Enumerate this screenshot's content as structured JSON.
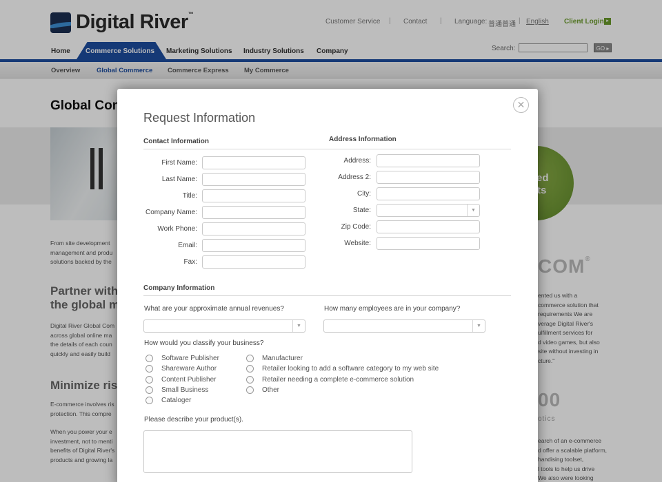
{
  "header": {
    "logo_text": "Digital River",
    "logo_tm": "™",
    "util_links": {
      "customer_service": "Customer Service",
      "contact": "Contact",
      "language_label": "Language:",
      "language_other": "普通普通",
      "language_current": "English",
      "separator": "|"
    },
    "client_login": "Client Login",
    "client_login_arrow": "▸",
    "search_label": "Search:",
    "search_go": "GO ▸"
  },
  "nav": {
    "home": "Home",
    "commerce_solutions": "Commerce Solutions",
    "marketing_solutions": "Marketing Solutions",
    "industry_solutions": "Industry Solutions",
    "company": "Company"
  },
  "subnav": {
    "overview": "Overview",
    "global_commerce": "Global Commerce",
    "commerce_express": "Commerce Express",
    "my_commerce": "My Commerce"
  },
  "background": {
    "page_title": "Global Com",
    "green_line1": "ured",
    "green_line2": "ts",
    "intro_lines": [
      "From site development",
      "management and produ",
      "solutions backed by the"
    ],
    "partner_heading_lines": [
      "Partner with",
      "the global m"
    ],
    "partner_lines": [
      "Digital River Global Com",
      "across global online ma",
      "the details of each coun",
      "quickly and easily build"
    ],
    "minimize_heading": "Minimize risk",
    "risk_lines": [
      "E-commerce involves ris",
      "protection. This compre"
    ],
    "power_lines": [
      "When you power your e",
      "investment, not to menti",
      "benefits of Digital River's",
      "products and growing la"
    ],
    "right_logo1": "COM",
    "right_logo1_reg": "®",
    "right_quote1_lines": [
      "ented us with a",
      "commerce solution that",
      "requirements We are",
      "verage Digital River's",
      "ulfillment services for",
      "d video games, but also",
      "site without investing in",
      "cture.\""
    ],
    "right_logo2": "00",
    "right_logo2_small": "otics",
    "right_quote2_lines": [
      "earch of an e-commerce",
      "d offer a scalable platform,",
      "handising toolset,",
      "l tools to help us drive",
      "We also were looking"
    ]
  },
  "modal": {
    "title": "Request Information",
    "close_glyph": "✕",
    "contact_section": "Contact Information",
    "address_section": "Address Information",
    "contact_fields": {
      "first_name": "First Name:",
      "last_name": "Last Name:",
      "title": "Title:",
      "company_name": "Company Name:",
      "work_phone": "Work Phone:",
      "email": "Email:",
      "fax": "Fax:"
    },
    "address_fields": {
      "address": "Address:",
      "address2": "Address 2:",
      "city": "City:",
      "state": "State:",
      "zip": "Zip Code:",
      "website": "Website:"
    },
    "select_caret": "▼",
    "company_section": "Company Information",
    "q_revenues": "What are your approximate annual revenues?",
    "q_employees": "How many employees are in your company?",
    "q_classify": "How would you classify your business?",
    "business_types_left": [
      "Software Publisher",
      "Shareware Author",
      "Content Publisher",
      "Small Business",
      "Cataloger"
    ],
    "business_types_right": [
      "Manufacturer",
      "Retailer looking to add a software category to my web site",
      "Retailer needing a complete e-commerce solution",
      "Other"
    ],
    "q_products": "Please describe your product(s)."
  }
}
